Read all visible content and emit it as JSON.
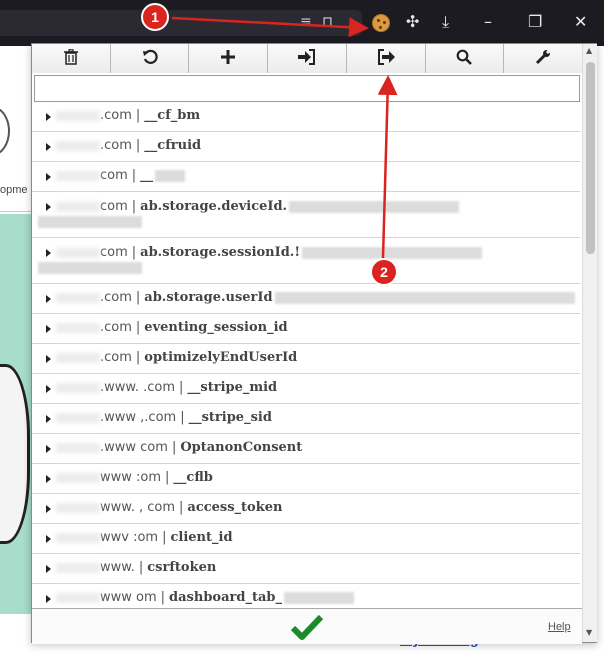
{
  "browser": {
    "toolbar_icons": [
      "reader-icon",
      "bookmark-icon",
      "cookie-extension-icon",
      "extensions-puzzle-icon",
      "download-icon",
      "minimize-icon",
      "restore-icon",
      "close-icon"
    ],
    "minimize_glyph": "–",
    "restore_glyph": "❐",
    "close_glyph": "✕",
    "download_glyph": "⤓",
    "puzzle_glyph": "✣",
    "reader_glyph": "≡",
    "bookmark_glyph": "⊓"
  },
  "background": {
    "partial_text": "opme",
    "link_text": "my learning"
  },
  "toolbar": {
    "delete_glyph": "🗑",
    "reset_glyph": "↻",
    "add_glyph": "+",
    "import_glyph": "⇥",
    "export_glyph": "⇨",
    "search_glyph": "⌕",
    "options_glyph": "🔧"
  },
  "filter": {
    "value": ""
  },
  "cookies": [
    {
      "host": ".com",
      "sep": "|",
      "name": "__cf_bm"
    },
    {
      "host": ".com",
      "sep": "|",
      "name": "__cfruid"
    },
    {
      "host": "com",
      "sep": "|",
      "name": "__"
    },
    {
      "host": "com",
      "sep": "|",
      "name": "ab.storage.deviceId."
    },
    {
      "host": "com",
      "sep": "|",
      "name": "ab.storage.sessionId.!"
    },
    {
      "host": ".com",
      "sep": "|",
      "name": "ab.storage.userId"
    },
    {
      "host": ".com",
      "sep": "|",
      "name": "eventing_session_id"
    },
    {
      "host": ".com",
      "sep": "|",
      "name": "optimizelyEndUserId"
    },
    {
      "host": ".www.  .com",
      "sep": "|",
      "name": "__stripe_mid"
    },
    {
      "host": ".www  ,.com",
      "sep": "|",
      "name": "__stripe_sid"
    },
    {
      "host": ".www  com",
      "sep": "|",
      "name": "OptanonConsent"
    },
    {
      "host": "www  :om",
      "sep": "|",
      "name": "__cflb"
    },
    {
      "host": "www.  , com",
      "sep": "|",
      "name": "access_token"
    },
    {
      "host": "wwv  :om",
      "sep": "|",
      "name": "client_id"
    },
    {
      "host": "www.",
      "sep": "|",
      "name": "csrftoken"
    },
    {
      "host": "www  om",
      "sep": "|",
      "name": "dashboard_tab_"
    }
  ],
  "footer": {
    "help_label": "Help"
  },
  "annotations": {
    "badge_1": "1",
    "badge_2": "2",
    "color": "#d9241f"
  }
}
